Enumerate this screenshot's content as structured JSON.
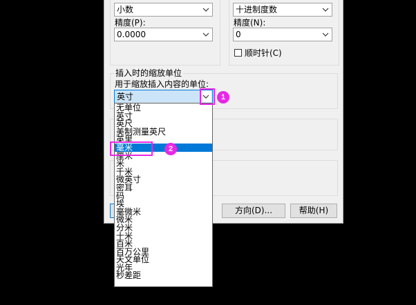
{
  "length": {
    "type_value": "小数",
    "precision_label": "精度(P):",
    "precision_value": "0.0000"
  },
  "angle": {
    "type_value": "十进制度数",
    "precision_label": "精度(N):",
    "precision_value": "0",
    "clockwise_label": "顺时针(C)"
  },
  "insert_scale": {
    "group_title": "插入时的缩放单位",
    "label": "用于缩放插入内容的单位:",
    "value": "英寸",
    "options": [
      "无单位",
      "英寸",
      "英尺",
      "美制测量英尺",
      "英里",
      "毫米",
      "厘米",
      "米",
      "千米",
      "微英寸",
      "密耳",
      "码",
      "埃",
      "毫微米",
      "微米",
      "分米",
      "十米",
      "百米",
      "百万公里",
      "天文单位",
      "光年",
      "秒差距"
    ],
    "selected_index": 5
  },
  "buttons": {
    "direction": "方向(D)...",
    "help": "帮助(H)"
  },
  "annotations": {
    "badge1": "1",
    "badge2": "2",
    "color": "#e628e6"
  }
}
